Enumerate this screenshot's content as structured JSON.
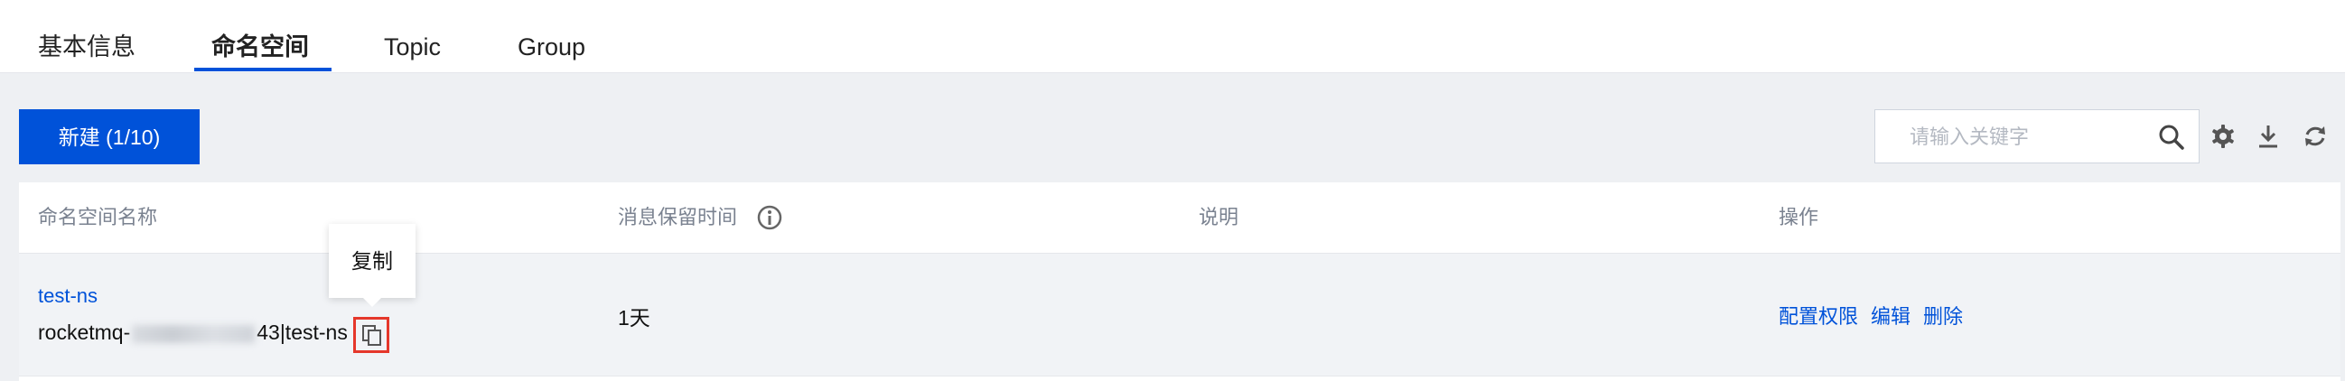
{
  "tabs": [
    {
      "label": "基本信息",
      "active": false
    },
    {
      "label": "命名空间",
      "active": true
    },
    {
      "label": "Topic",
      "active": false
    },
    {
      "label": "Group",
      "active": false
    }
  ],
  "toolbar": {
    "new_button_label": "新建 (1/10)",
    "search_placeholder": "请输入关键字",
    "icons": [
      "search-icon",
      "settings-icon",
      "download-icon",
      "refresh-icon"
    ]
  },
  "table": {
    "columns": [
      "命名空间名称",
      "消息保留时间",
      "说明",
      "操作"
    ],
    "rows": [
      {
        "name": "test-ns",
        "id_prefix": "rocketmq-",
        "id_suffix": "43|test-ns",
        "retention": "1天",
        "description": "",
        "actions": [
          "配置权限",
          "编辑",
          "删除"
        ]
      }
    ]
  },
  "tooltip": {
    "text": "复制"
  },
  "colors": {
    "accent": "#0052d9",
    "highlight": "#e5372b",
    "background": "#eef0f3"
  }
}
